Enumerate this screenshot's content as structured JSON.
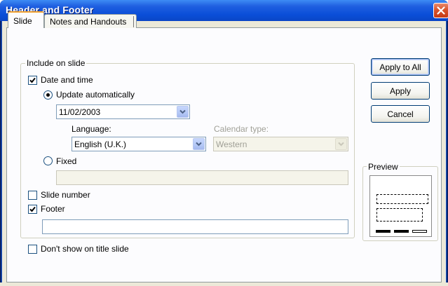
{
  "window": {
    "title": "Header and Footer"
  },
  "tabs": [
    {
      "label": "Slide",
      "selected": true
    },
    {
      "label": "Notes and Handouts",
      "selected": false
    }
  ],
  "include_group": {
    "legend": "Include on slide",
    "date_and_time": {
      "label": "Date and time",
      "checked": true
    },
    "update_automatically": {
      "label": "Update automatically",
      "selected": true
    },
    "date_value": "11/02/2003",
    "language": {
      "label": "Language:",
      "value": "English (U.K.)"
    },
    "calendar_type": {
      "label": "Calendar type:",
      "value": "Western",
      "disabled": true
    },
    "fixed": {
      "label": "Fixed",
      "selected": false,
      "value": ""
    },
    "slide_number": {
      "label": "Slide number",
      "checked": false
    },
    "footer": {
      "label": "Footer",
      "checked": true,
      "value": ""
    }
  },
  "dont_show_on_title": {
    "label": "Don't show on title slide",
    "checked": false
  },
  "buttons": {
    "apply_to_all": "Apply to All",
    "apply": "Apply",
    "cancel": "Cancel"
  },
  "preview": {
    "legend": "Preview"
  },
  "icons": {
    "close": "close-icon",
    "dropdown": "chevron-down-icon",
    "checkmark": "checkmark-icon"
  },
  "colors": {
    "titlebar": "#0a4ed8",
    "dialog_bg": "#ece9d8",
    "panel_bg": "#fcfcfe",
    "close_button": "#d8542c",
    "tab_highlight": "#f0a030"
  }
}
